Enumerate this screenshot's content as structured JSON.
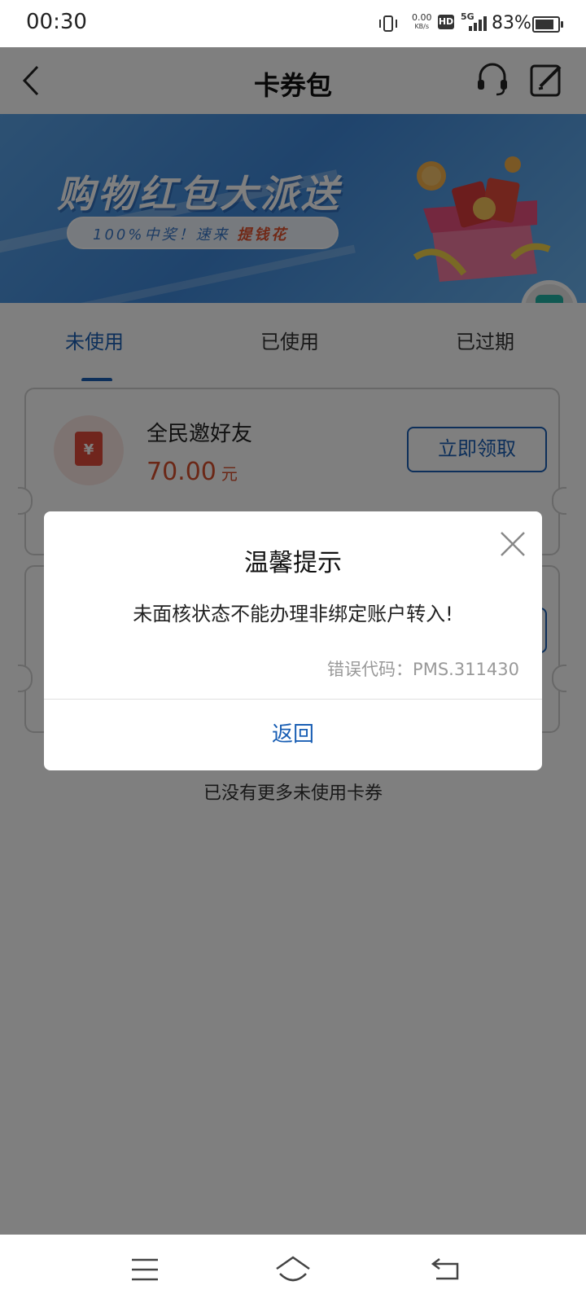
{
  "status_bar": {
    "time": "00:30",
    "net_speed_value": "0.00",
    "net_speed_unit": "KB/s",
    "hd_label": "HD",
    "network_type": "5G",
    "battery_percent": "83%"
  },
  "nav": {
    "title": "卡券包",
    "back_icon": "chevron-left-icon",
    "support_icon": "headset-icon",
    "edit_icon": "edit-icon"
  },
  "banner": {
    "headline": "购物红包大派送",
    "sub_prefix": "100%中奖！速来",
    "sub_highlight": "提钱花"
  },
  "tabs": [
    {
      "label": "未使用",
      "active": true
    },
    {
      "label": "已使用",
      "active": false
    },
    {
      "label": "已过期",
      "active": false
    }
  ],
  "coupons": [
    {
      "name": "全民邀好友",
      "amount": "70.00",
      "unit": "元",
      "action_label": "立即领取",
      "icon": "red-envelope-icon"
    }
  ],
  "list_footer": "已没有更多未使用卡券",
  "dialog": {
    "title": "温馨提示",
    "message": "未面核状态不能办理非绑定账户转入!",
    "error_code": "错误代码：PMS.311430",
    "confirm_label": "返回",
    "close_icon": "close-icon"
  },
  "colors": {
    "accent": "#1a5fb4",
    "amount": "#d64e2c",
    "overlay": "rgba(0,0,0,0.5)"
  }
}
